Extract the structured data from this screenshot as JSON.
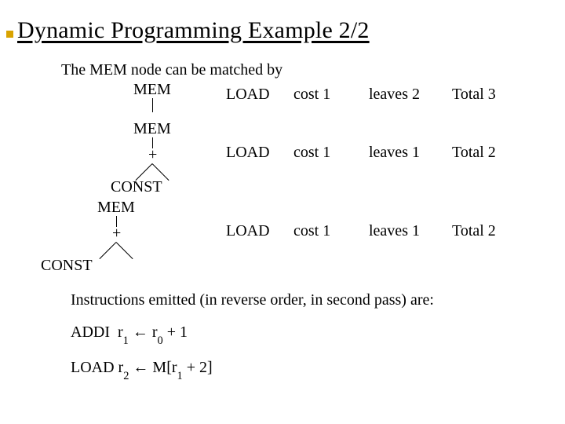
{
  "title": "Dynamic Programming Example 2/2",
  "intro": "The MEM node can be matched by",
  "examples": [
    {
      "tree": {
        "root": "MEM",
        "plus": null,
        "leaf": null
      },
      "op": "LOAD",
      "cost": "cost 1",
      "leaves": "leaves 2",
      "total": "Total 3"
    },
    {
      "tree": {
        "root": "MEM",
        "plus": "+",
        "leaf": "CONST"
      },
      "op": "LOAD",
      "cost": "cost 1",
      "leaves": "leaves 1",
      "total": "Total 2"
    },
    {
      "tree": {
        "root": "MEM",
        "plus": "+",
        "leaf": "CONST"
      },
      "op": "LOAD",
      "cost": "cost 1",
      "leaves": "leaves 1",
      "total": "Total 2"
    }
  ],
  "emitted_caption": "Instructions emitted (in reverse order, in second pass) are:",
  "instructions": [
    {
      "op": "ADDI",
      "dst_pre": "r",
      "dst_sub": "1",
      "arrow": "←",
      "src1_pre": "r",
      "src1_sub": "0",
      "tail": " + 1"
    },
    {
      "op": "LOAD",
      "dst_pre": "r",
      "dst_sub": "2",
      "arrow": "←",
      "src1_pre": "M[r",
      "src1_sub": "1",
      "tail": " + 2]"
    }
  ]
}
